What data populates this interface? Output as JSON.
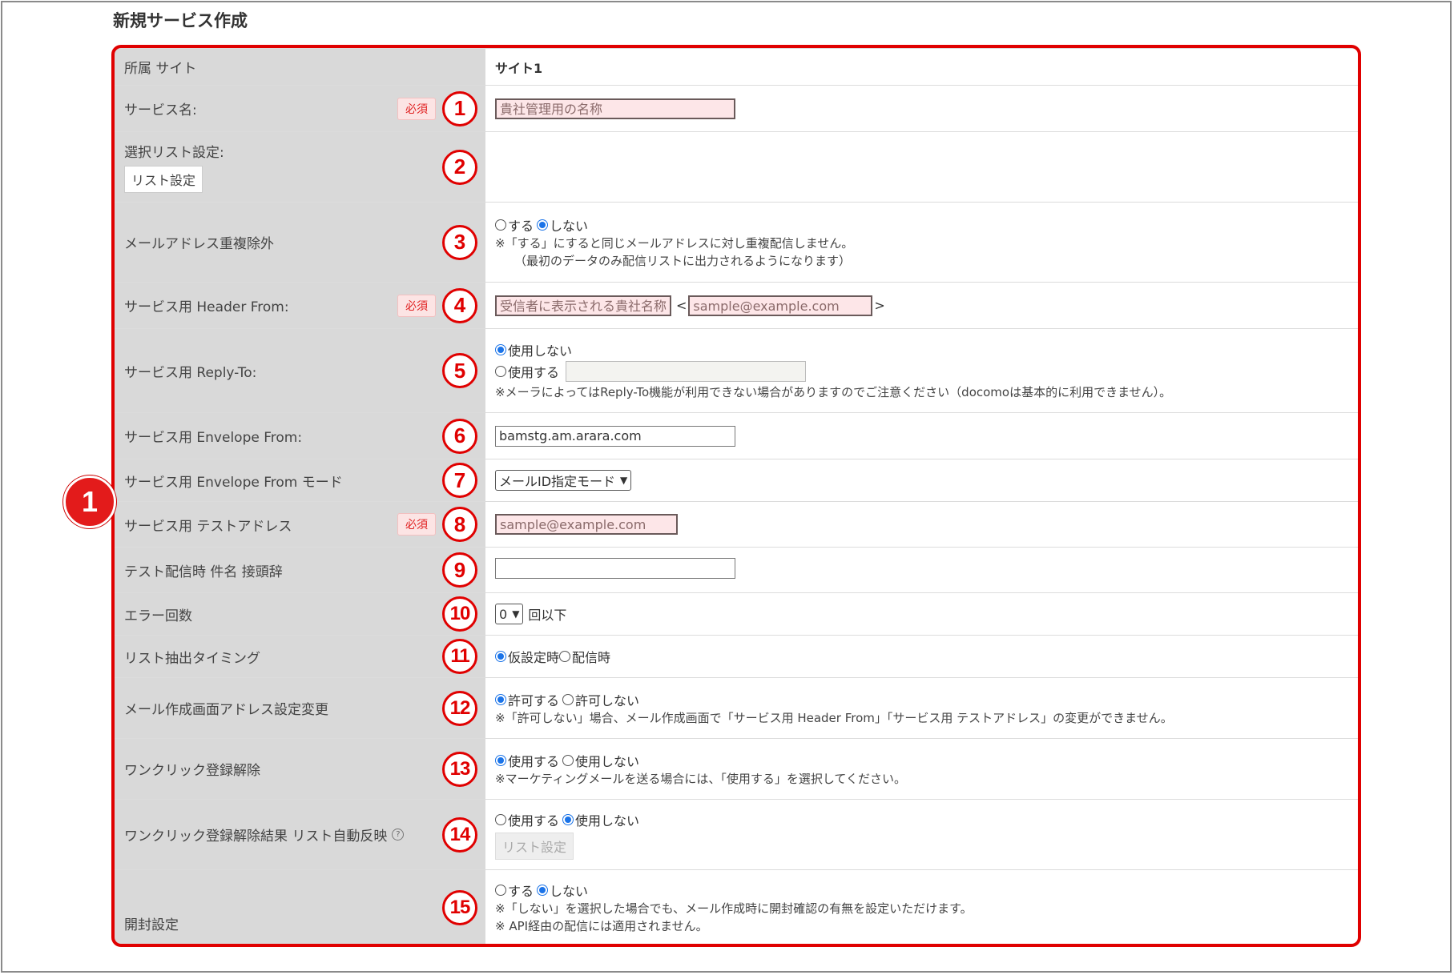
{
  "page": {
    "title": "新規サービス作成"
  },
  "callout": {
    "main_number": "1"
  },
  "badges": {
    "required": "必須"
  },
  "rows": {
    "site": {
      "label": "所属 サイト",
      "value": "サイト1"
    },
    "service_name": {
      "label": "サービス名:",
      "number": "1",
      "placeholder": "貴社管理用の名称"
    },
    "select_list": {
      "label": "選択リスト設定:",
      "number": "2",
      "button": "リスト設定"
    },
    "dedupe": {
      "label": "メールアドレス重複除外",
      "number": "3",
      "option_yes": "する",
      "option_no": "しない",
      "note1": "※「する」にすると同じメールアドレスに対し重複配信しません。",
      "note2": "（最初のデータのみ配信リストに出力されるようになります）"
    },
    "header_from": {
      "label": "サービス用 Header From:",
      "number": "4",
      "name_placeholder": "受信者に表示される貴社名称",
      "lt": "<",
      "gt": ">",
      "email_placeholder": "sample@example.com"
    },
    "reply_to": {
      "label": "サービス用 Reply-To:",
      "number": "5",
      "option_off": "使用しない",
      "option_on": "使用する",
      "note": "※メーラによってはReply-To機能が利用できない場合がありますのでご注意ください（docomoは基本的に利用できません）。"
    },
    "envelope_from": {
      "label": "サービス用 Envelope From:",
      "number": "6",
      "value": "bamstg.am.arara.com"
    },
    "envelope_mode": {
      "label": "サービス用 Envelope From モード",
      "number": "7",
      "selected": "メールID指定モード"
    },
    "test_address": {
      "label": "サービス用 テストアドレス",
      "number": "8",
      "placeholder": "sample@example.com"
    },
    "test_prefix": {
      "label": "テスト配信時 件名 接頭辞",
      "number": "9",
      "value": ""
    },
    "error_count": {
      "label": "エラー回数",
      "number": "10",
      "selected": "0",
      "suffix": "回以下"
    },
    "extract_timing": {
      "label": "リスト抽出タイミング",
      "number": "11",
      "option_a": "仮設定時",
      "option_b": "配信時"
    },
    "address_change": {
      "label": "メール作成画面アドレス設定変更",
      "number": "12",
      "option_allow": "許可する",
      "option_deny": "許可しない",
      "note": "※「許可しない」場合、メール作成画面で「サービス用 Header From」「サービス用 テストアドレス」の変更ができません。"
    },
    "one_click": {
      "label": "ワンクリック登録解除",
      "number": "13",
      "option_use": "使用する",
      "option_nouse": "使用しない",
      "note": "※マーケティングメールを送る場合には、「使用する」を選択してください。"
    },
    "one_click_result": {
      "label": "ワンクリック登録解除結果 リスト自動反映",
      "number": "14",
      "help": "?",
      "option_use": "使用する",
      "option_nouse": "使用しない",
      "button": "リスト設定"
    },
    "open_setting": {
      "label": "開封設定",
      "number": "15",
      "option_yes": "する",
      "option_no": "しない",
      "note1": "※「しない」を選択した場合でも、メール作成時に開封確認の有無を設定いただけます。",
      "note2": "※ API経由の配信には適用されません。"
    }
  }
}
